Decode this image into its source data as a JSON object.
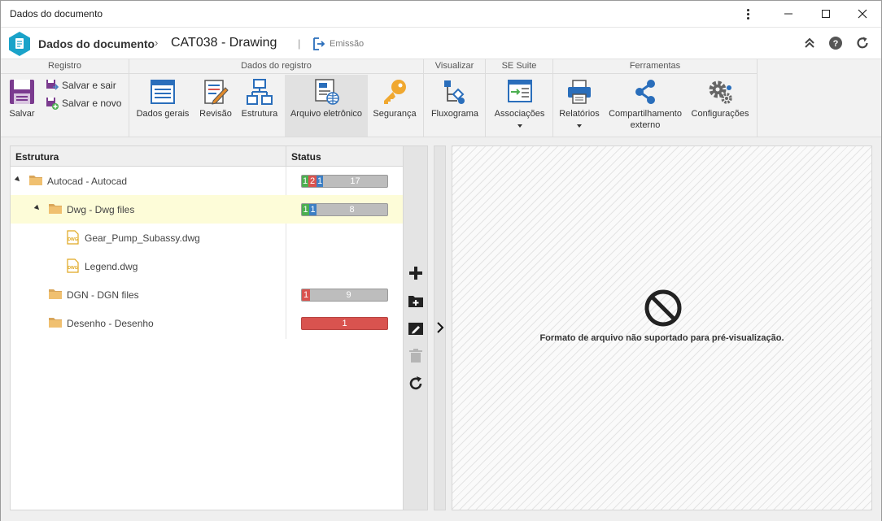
{
  "window": {
    "title": "Dados do documento"
  },
  "header": {
    "app": "Dados do documento",
    "separator": "›",
    "document": "CAT038 - Drawing",
    "pipe": "|",
    "emissao": "Emissão"
  },
  "ribbon": {
    "groups": {
      "registro": "Registro",
      "dados_registro": "Dados do registro",
      "visualizar": "Visualizar",
      "se_suite": "SE Suite",
      "ferramentas": "Ferramentas"
    },
    "salvar": "Salvar",
    "salvar_sair": "Salvar e sair",
    "salvar_novo": "Salvar e novo",
    "dados_gerais": "Dados gerais",
    "revisao": "Revisão",
    "estrutura": "Estrutura",
    "arquivo_eletronico": "Arquivo eletrônico",
    "seguranca": "Segurança",
    "fluxograma": "Fluxograma",
    "associacoes": "Associações",
    "relatorios": "Relatórios",
    "compartilhamento": "Compartilhamento externo",
    "configuracoes": "Configurações"
  },
  "tree": {
    "col_estrutura": "Estrutura",
    "col_status": "Status",
    "rows": [
      {
        "name": "Autocad - Autocad",
        "type": "folder",
        "expanded": true,
        "status": [
          {
            "v": "1",
            "c": "#4caf50"
          },
          {
            "v": "2",
            "c": "#d9534f"
          },
          {
            "v": "1",
            "c": "#3d7fc4"
          }
        ],
        "rest": "17"
      },
      {
        "name": "Dwg - Dwg files",
        "type": "folder",
        "expanded": true,
        "selected": true,
        "status": [
          {
            "v": "1",
            "c": "#4caf50"
          },
          {
            "v": "1",
            "c": "#3d7fc4"
          }
        ],
        "rest": "8"
      },
      {
        "name": "Gear_Pump_Subassy.dwg",
        "type": "file"
      },
      {
        "name": "Legend.dwg",
        "type": "file"
      },
      {
        "name": "DGN - DGN files",
        "type": "folder",
        "status": [
          {
            "v": "1",
            "c": "#d9534f"
          }
        ],
        "rest": "9"
      },
      {
        "name": "Desenho - Desenho",
        "type": "folder",
        "status_full": {
          "v": "1",
          "c": "#d9534f"
        }
      }
    ]
  },
  "file_icon_label": "DWG",
  "preview": {
    "message": "Formato de arquivo não suportado para pré-visualização."
  },
  "colors": {
    "accent": "#1aa3c9",
    "ribbon_bg": "#f2f2f2",
    "selected_row": "#fdfcd8"
  }
}
